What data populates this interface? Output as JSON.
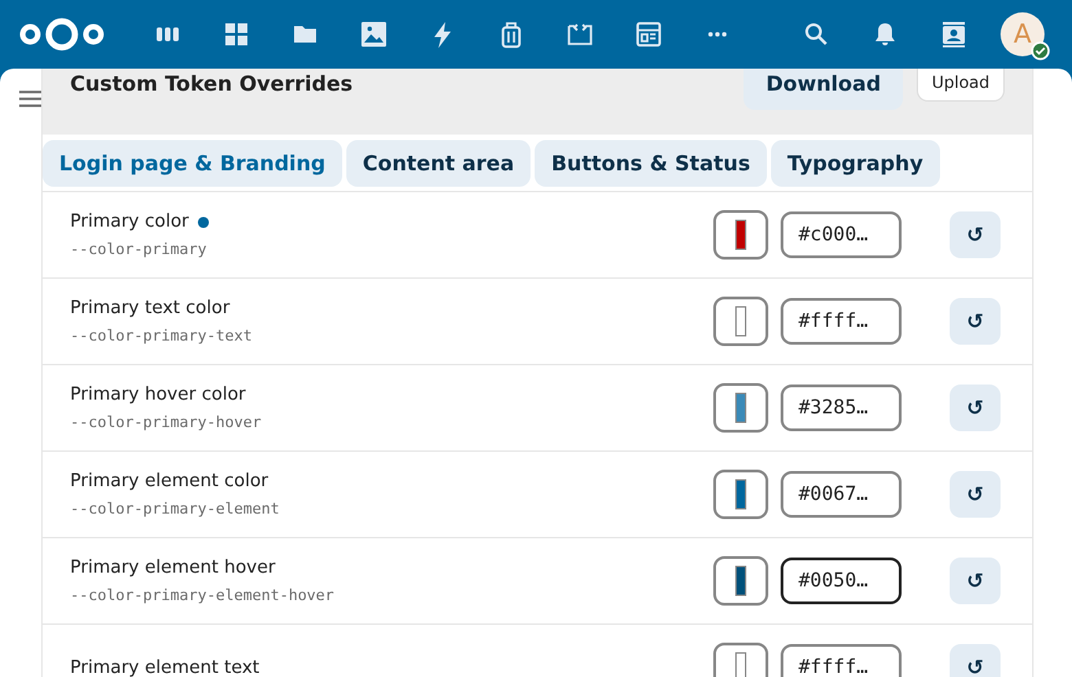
{
  "header": {
    "apps": [
      {
        "kind": "grid3"
      },
      {
        "kind": "dashboard"
      },
      {
        "kind": "folder"
      },
      {
        "kind": "image"
      },
      {
        "kind": "bolt"
      },
      {
        "kind": "bag"
      },
      {
        "kind": "code"
      },
      {
        "kind": "table"
      },
      {
        "kind": "more"
      }
    ],
    "avatar": {
      "initial": "A",
      "online": true
    }
  },
  "panel": {
    "title": "Custom Token Overrides",
    "download": "Download",
    "upload": "Upload"
  },
  "tabs": [
    {
      "label": "Login page & Branding",
      "selected": true
    },
    {
      "label": "Content area",
      "selected": false
    },
    {
      "label": "Buttons & Status",
      "selected": false
    },
    {
      "label": "Typography",
      "selected": false
    }
  ],
  "tokens": [
    {
      "label": "Primary color",
      "variable": "--color-primary",
      "modified": true,
      "color": "#c00000",
      "value": "#c000…",
      "focused": false
    },
    {
      "label": "Primary text color",
      "variable": "--color-primary-text",
      "modified": false,
      "color": "#ffffff",
      "value": "#ffff…",
      "focused": false
    },
    {
      "label": "Primary hover color",
      "variable": "--color-primary-hover",
      "modified": false,
      "color": "#3a8ab8",
      "value": "#3285…",
      "focused": false
    },
    {
      "label": "Primary element color",
      "variable": "--color-primary-element",
      "modified": false,
      "color": "#00679e",
      "value": "#0067…",
      "focused": false
    },
    {
      "label": "Primary element hover",
      "variable": "--color-primary-element-hover",
      "modified": false,
      "color": "#00507a",
      "value": "#0050…",
      "focused": true
    },
    {
      "label": "Primary element text",
      "modified": false,
      "color": "#ffffff",
      "value": "#ffff…",
      "focused": false
    }
  ],
  "reset_symbol": "↺"
}
